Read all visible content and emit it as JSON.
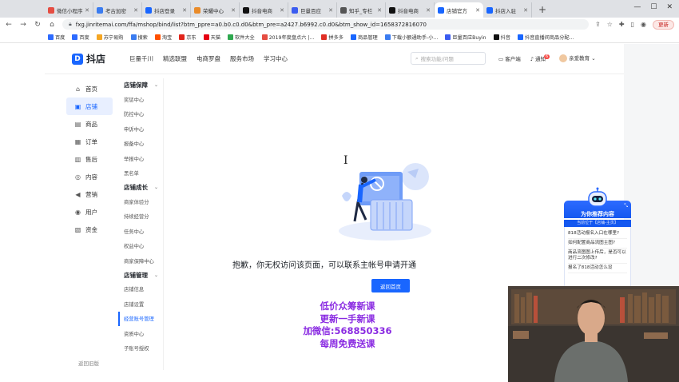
{
  "browser": {
    "tabs": [
      {
        "label": "微信小程序",
        "color": "#e54d42"
      },
      {
        "label": "考古加密",
        "color": "#3b7cf0"
      },
      {
        "label": "抖店登录",
        "color": "#1966ff"
      },
      {
        "label": "荣耀中心",
        "color": "#e98b2a"
      },
      {
        "label": "抖音电商",
        "color": "#111111"
      },
      {
        "label": "巨量百应",
        "color": "#3b5cf0"
      },
      {
        "label": "知乎_专栏",
        "color": "#555555"
      },
      {
        "label": "抖音电商",
        "color": "#111111"
      },
      {
        "label": "店铺官方",
        "color": "#1966ff",
        "active": true
      },
      {
        "label": "抖店入驻",
        "color": "#1966ff"
      }
    ],
    "new_tab": "+",
    "url": "fxg.jinritemai.com/ffa/mshop/bind/list?btm_ppre=a0.b0.c0.d0&btm_pre=a2427.b6992.c0.d0&btm_show_id=1658372816070",
    "update_label": "更新",
    "bookmarks": [
      {
        "label": "百度",
        "color": "#2d6bff"
      },
      {
        "label": "百度",
        "color": "#2d6bff"
      },
      {
        "label": "苏宁易购",
        "color": "#f5a623"
      },
      {
        "label": "搜索",
        "color": "#3b7cf0"
      },
      {
        "label": "淘宝",
        "color": "#ff5000"
      },
      {
        "label": "京东",
        "color": "#e1251b"
      },
      {
        "label": "天猫",
        "color": "#e60012"
      },
      {
        "label": "软件大全",
        "color": "#2fa84f"
      },
      {
        "label": "2019年度盘点六 |...",
        "color": "#e54d42"
      },
      {
        "label": "拼多多",
        "color": "#e02e24"
      },
      {
        "label": "商品管理",
        "color": "#1966ff"
      },
      {
        "label": "下载小额通助手-小...",
        "color": "#3b7cf0"
      },
      {
        "label": "巨量百应Buyin",
        "color": "#3b5cf0"
      },
      {
        "label": "抖音",
        "color": "#111111"
      },
      {
        "label": "抖音直播间商品分配...",
        "color": "#1966ff"
      }
    ]
  },
  "header": {
    "logo_mark": "D",
    "logo_text": "抖店",
    "nav": [
      "巨量千川",
      "精选联盟",
      "电商罗盘",
      "服务市场",
      "学习中心"
    ],
    "search_placeholder": "搜索功能/问题",
    "service_label": "客户端",
    "notice_label": "通知",
    "notice_count": "6",
    "user_label": "亲爱教育"
  },
  "leftnav": {
    "items": [
      {
        "label": "首页",
        "icon": "home-icon",
        "glyph": "⌂"
      },
      {
        "label": "店铺",
        "icon": "shop-icon",
        "glyph": "▣",
        "active": true
      },
      {
        "label": "商品",
        "icon": "goods-icon",
        "glyph": "▤"
      },
      {
        "label": "订单",
        "icon": "order-icon",
        "glyph": "▦"
      },
      {
        "label": "售后",
        "icon": "aftersale-icon",
        "glyph": "▥"
      },
      {
        "label": "内容",
        "icon": "content-icon",
        "glyph": "◎"
      },
      {
        "label": "营销",
        "icon": "marketing-icon",
        "glyph": "◀"
      },
      {
        "label": "用户",
        "icon": "user-icon",
        "glyph": "◉"
      },
      {
        "label": "资金",
        "icon": "fund-icon",
        "glyph": "▧"
      }
    ],
    "back_label": "返回旧版"
  },
  "subnav": {
    "groups": [
      {
        "title": "店铺保障",
        "items": [
          "奖惩中心",
          "防控中心",
          "申诉中心",
          "报备中心",
          "举报中心",
          "黑名单"
        ]
      },
      {
        "title": "店铺成长",
        "items": [
          "商家体验分",
          "持续经营分",
          "任务中心",
          "权益中心",
          "商家保障中心"
        ]
      },
      {
        "title": "店铺管理",
        "items": [
          "店铺信息",
          "店铺设置",
          "经营账号管理",
          "资质中心",
          "子账号授权"
        ],
        "active_index": 2
      }
    ]
  },
  "main": {
    "message": "抱歉，你无权访问该页面，可以联系主帐号申请开通",
    "home_button": "返回首页"
  },
  "promo": {
    "lines": [
      {
        "text": "低价众筹新课",
        "color": "#8a2be2"
      },
      {
        "text": "更新一手新课",
        "color": "#8a2be2"
      },
      {
        "text": "加微信:568850336",
        "color": "#8a2be2"
      },
      {
        "text": "每周免费送课",
        "color": "#8a2be2"
      }
    ]
  },
  "chat": {
    "title": "为你推荐内容",
    "subtitle": "当前位于【店铺-主页】",
    "questions": [
      "818活动报名入口在哪里?",
      "如何配置商品流图主图?",
      "商品流图图上传后，是否可以进行二次修改?",
      "报名了818活动怎么设"
    ]
  },
  "colors": {
    "brand": "#1966ff",
    "promo": "#8a2be2"
  }
}
